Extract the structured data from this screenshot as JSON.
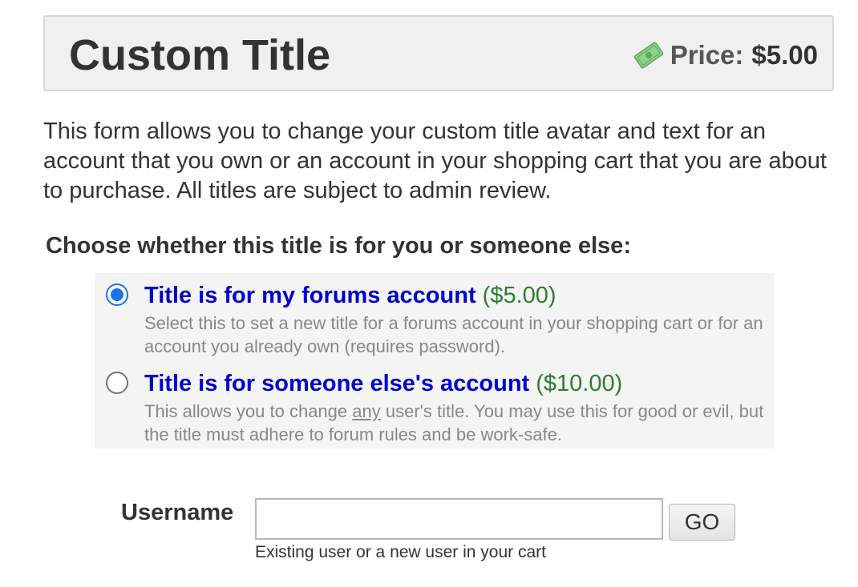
{
  "header": {
    "title": "Custom Title",
    "price_label": "Price:",
    "price_value": "$5.00",
    "price_icon": "money-icon"
  },
  "intro": "This form allows you to change your custom title avatar and text for an account that you own or an account in your shopping cart that you are about to purchase. All titles are subject to admin review.",
  "choose_heading": "Choose whether this title is for you or someone else:",
  "options": [
    {
      "label": "Title is for my forums account",
      "price": "($5.00)",
      "description": "Select this to set a new title for a forums account in your shopping cart or for an account you already own (requires password).",
      "selected": true
    },
    {
      "label": "Title is for someone else's account",
      "price": "($10.00)",
      "description_before": "This allows you to change ",
      "description_emphasis": "any",
      "description_after": " user's title. You may use this for good or evil, but the title must adhere to forum rules and be work-safe.",
      "selected": false
    }
  ],
  "username": {
    "label": "Username",
    "value": "",
    "placeholder": "",
    "go_label": "GO",
    "hint": "Existing user or a new user in your cart"
  },
  "colors": {
    "link_blue": "#0000cc",
    "price_green": "#2e7d32",
    "radio_blue": "#1a73e8",
    "money_green": "#7cc47a"
  }
}
